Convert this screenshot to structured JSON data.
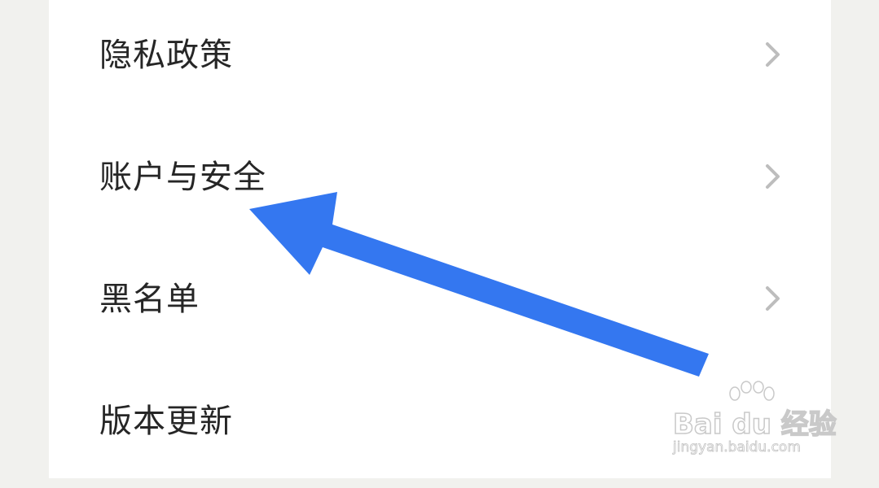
{
  "settings_menu": {
    "items": [
      {
        "label": "隐私政策",
        "chevron": "chevron-right-icon"
      },
      {
        "label": "账户与安全",
        "chevron": "chevron-right-icon"
      },
      {
        "label": "黑名单",
        "chevron": "chevron-right-icon"
      },
      {
        "label": "版本更新",
        "chevron": null
      }
    ]
  },
  "annotation": {
    "arrow_color": "#3477f0",
    "icon": "arrow-icon"
  },
  "watermark": {
    "logo_text": "Bai du 经验",
    "url": "jingyan.baidu.com"
  },
  "colors": {
    "background": "#f1f1ee",
    "panel": "#ffffff",
    "label": "#262626",
    "chevron": "#bdbdbd"
  }
}
